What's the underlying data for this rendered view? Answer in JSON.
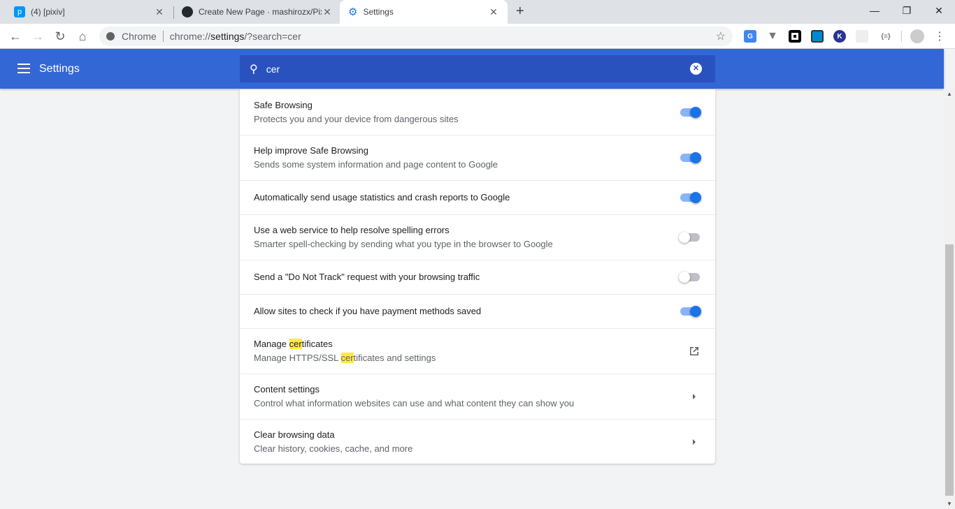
{
  "tabs": [
    {
      "title": "(4) [pixiv]",
      "icon": "pixiv-icon"
    },
    {
      "title": "Create New Page · mashirozx/Pixiv",
      "icon": "github-icon"
    },
    {
      "title": "Settings",
      "icon": "gear-icon",
      "active": true
    }
  ],
  "omnibox": {
    "site_label": "Chrome",
    "url_prefix": "chrome://",
    "url_host": "settings",
    "url_rest": "/?search=cer"
  },
  "header": {
    "title": "Settings",
    "search_value": "cer"
  },
  "accent": "#1a73e8",
  "rows": [
    {
      "title": "Safe Browsing",
      "desc": "Protects you and your device from dangerous sites",
      "control": "toggle",
      "on": true
    },
    {
      "title": "Help improve Safe Browsing",
      "desc": "Sends some system information and page content to Google",
      "control": "toggle",
      "on": true
    },
    {
      "title": "Automatically send usage statistics and crash reports to Google",
      "control": "toggle",
      "on": true
    },
    {
      "title": "Use a web service to help resolve spelling errors",
      "desc": "Smarter spell-checking by sending what you type in the browser to Google",
      "control": "toggle",
      "on": false
    },
    {
      "title": "Send a \"Do Not Track\" request with your browsing traffic",
      "control": "toggle",
      "on": false
    },
    {
      "title": "Allow sites to check if you have payment methods saved",
      "control": "toggle",
      "on": true
    },
    {
      "title_parts": [
        "Manage ",
        "cer",
        "tificates"
      ],
      "desc_parts": [
        "Manage HTTPS/SSL ",
        "cer",
        "tificates and settings"
      ],
      "control": "open-in-new-icon"
    },
    {
      "title": "Content settings",
      "desc": "Control what information websites can use and what content they can show you",
      "control": "arrow-right-icon"
    },
    {
      "title": "Clear browsing data",
      "desc": "Clear history, cookies, cache, and more",
      "control": "arrow-right-icon"
    }
  ]
}
